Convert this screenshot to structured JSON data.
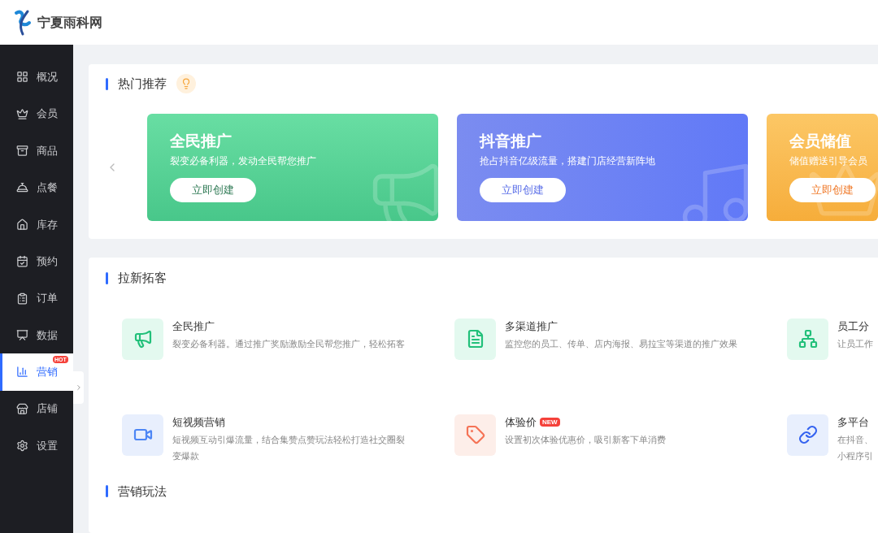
{
  "header": {
    "logo_text": "宁夏雨科网"
  },
  "sidebar": {
    "items": [
      {
        "label": "概况",
        "selected": false
      },
      {
        "label": "会员",
        "selected": false
      },
      {
        "label": "商品",
        "selected": false
      },
      {
        "label": "点餐",
        "selected": false
      },
      {
        "label": "库存",
        "selected": false
      },
      {
        "label": "预约",
        "selected": false
      },
      {
        "label": "订单",
        "selected": false
      },
      {
        "label": "数据",
        "selected": false
      },
      {
        "label": "营销",
        "selected": true,
        "badge": "HOT"
      },
      {
        "label": "店铺",
        "selected": false
      },
      {
        "label": "设置",
        "selected": false
      }
    ]
  },
  "hot": {
    "title": "热门推荐",
    "cards": [
      {
        "title": "全民推广",
        "desc": "裂变必备利器，发动全民帮您推广",
        "button": "立即创建"
      },
      {
        "title": "抖音推广",
        "desc": "抢占抖音亿级流量，搭建门店经营新阵地",
        "button": "立即创建"
      },
      {
        "title": "会员储值",
        "desc": "储值赠送引导会员",
        "button": "立即创建"
      }
    ]
  },
  "lead": {
    "title": "拉新拓客",
    "items": [
      {
        "title": "全民推广",
        "desc": [
          "裂变必备利器。通过推广奖励激励全民帮您推广，轻松拓客"
        ]
      },
      {
        "title": "多渠道推广",
        "desc": [
          "监控您的员工、传单、店内海报、易拉宝等渠道的推广效果"
        ]
      },
      {
        "title": "员工分",
        "desc": [
          "让员工作"
        ]
      },
      {
        "title": "短视频营销",
        "desc": [
          "短视频互动引爆流量，结合集赞点赞玩法轻松打造社交圈裂变爆款"
        ]
      },
      {
        "title": "体验价",
        "desc": [
          "设置初次体验优惠价，吸引新客下单消费"
        ],
        "badge": "NEW"
      },
      {
        "title": "多平台",
        "desc": [
          "在抖音、",
          "小程序引"
        ]
      }
    ]
  },
  "play": {
    "title": "营销玩法"
  }
}
